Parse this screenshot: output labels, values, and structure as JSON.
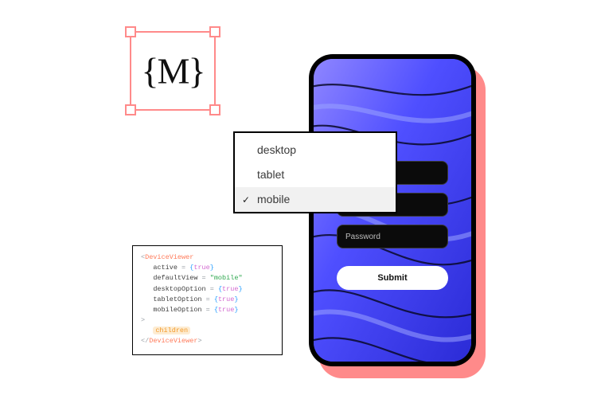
{
  "selection": {
    "glyph_left": "{",
    "glyph_mid": "M",
    "glyph_right": "}"
  },
  "dropdown": {
    "items": [
      {
        "label": "desktop",
        "selected": false
      },
      {
        "label": "tablet",
        "selected": false
      },
      {
        "label": "mobile",
        "selected": true
      }
    ],
    "check_glyph": "✓"
  },
  "phone": {
    "form": {
      "field1_placeholder": "",
      "field2_placeholder": "",
      "field3_placeholder": "Password",
      "submit_label": "Submit"
    }
  },
  "code": {
    "open_tag": "DeviceViewer",
    "close_tag": "DeviceViewer",
    "default_view_value": "\"mobile\"",
    "bool_true": "true",
    "children_slot": "children",
    "attrs": {
      "active": "active",
      "defaultView": "defaultView",
      "desktopOption": "desktopOption",
      "tabletOption": "tabletOption",
      "mobileOption": "mobileOption"
    },
    "eq": " = ",
    "lbrace": "{",
    "rbrace": "}",
    "lt": "<",
    "gt": ">",
    "slash": "/"
  }
}
